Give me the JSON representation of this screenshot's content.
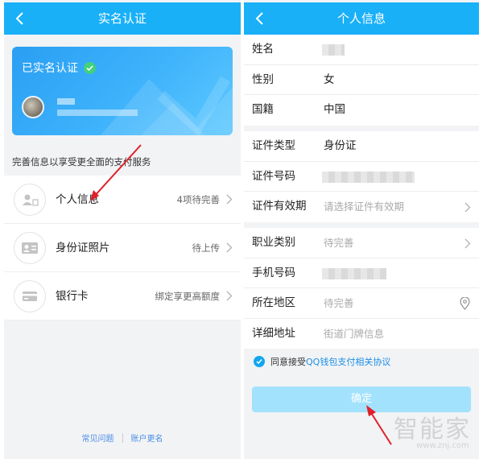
{
  "left": {
    "header": {
      "title": "实名认证"
    },
    "card": {
      "status": "已实名认证"
    },
    "hint": "完善信息以享受更全面的支付服务",
    "items": [
      {
        "label": "个人信息",
        "value": "4项待完善",
        "icon": "user-card-icon"
      },
      {
        "label": "身份证照片",
        "value": "待上传",
        "icon": "id-card-icon"
      },
      {
        "label": "银行卡",
        "value": "绑定享更高额度",
        "icon": "bank-card-icon"
      }
    ],
    "footer": {
      "faq": "常见问题",
      "rename": "账户更名"
    }
  },
  "right": {
    "header": {
      "title": "个人信息"
    },
    "basic": [
      {
        "label": "姓名",
        "value": ""
      },
      {
        "label": "性别",
        "value": "女"
      },
      {
        "label": "国籍",
        "value": "中国"
      }
    ],
    "id": [
      {
        "label": "证件类型",
        "value": "身份证"
      },
      {
        "label": "证件号码",
        "value": ""
      },
      {
        "label": "证件有效期",
        "placeholder": "请选择证件有效期"
      }
    ],
    "extra": [
      {
        "label": "职业类别",
        "placeholder": "待完善"
      },
      {
        "label": "手机号码",
        "value": ""
      },
      {
        "label": "所在地区",
        "placeholder": "待完善"
      },
      {
        "label": "详细地址",
        "placeholder": "街道门牌信息"
      }
    ],
    "agree": {
      "prefix": "同意接受",
      "link": "QQ钱包支付相关协议"
    },
    "confirm": "确定"
  },
  "watermark": {
    "name": "智能家",
    "url": "www.znj.com"
  },
  "colors": {
    "brand": "#19b0f8",
    "accent_link": "#1b8ee8",
    "confirm_bg": "#a3e2fc",
    "arrow": "#e0202a",
    "check": "#43d17a"
  }
}
